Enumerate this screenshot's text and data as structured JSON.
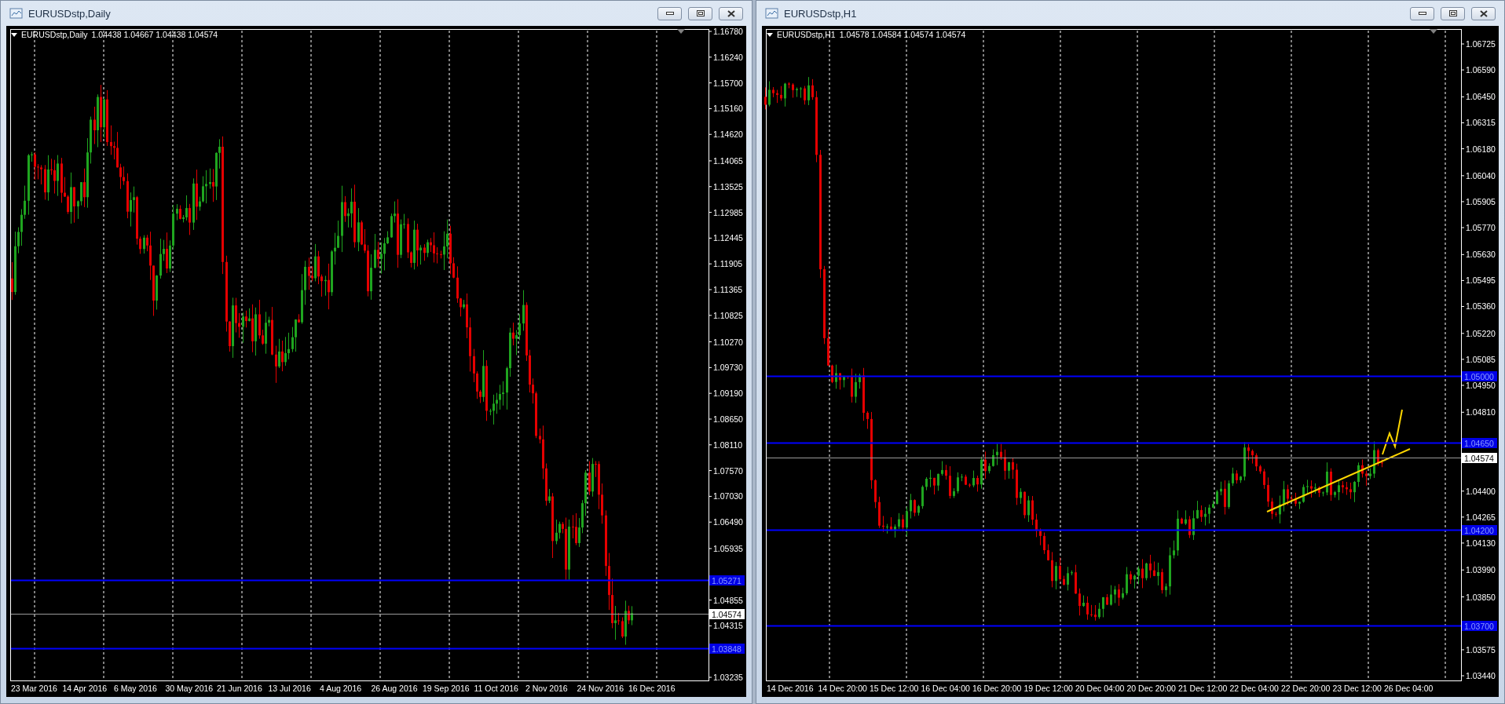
{
  "windows": [
    {
      "title": "EURUSDstp,Daily",
      "symbol": "EURUSDstp,Daily",
      "ohlc": "1.04438 1.04667 1.04438 1.04574",
      "price_axis": [
        "1.16780",
        "1.16240",
        "1.15700",
        "1.15160",
        "1.14620",
        "1.14065",
        "1.13525",
        "1.12985",
        "1.12445",
        "1.11905",
        "1.11365",
        "1.10825",
        "1.10270",
        "1.09730",
        "1.09190",
        "1.08650",
        "1.08110",
        "1.07570",
        "1.07030",
        "1.06490",
        "1.05935",
        "1.04855",
        "1.04315",
        "1.03235"
      ],
      "levels": [
        {
          "label": "1.05271",
          "kind": "line"
        },
        {
          "label": "1.04574",
          "kind": "bid"
        },
        {
          "label": "1.03848",
          "kind": "line"
        }
      ],
      "time_axis": [
        "23 Mar 2016",
        "14 Apr 2016",
        "6 May 2016",
        "30 May 2016",
        "21 Jun 2016",
        "13 Jul 2016",
        "4 Aug 2016",
        "26 Aug 2016",
        "19 Sep 2016",
        "11 Oct 2016",
        "2 Nov 2016",
        "24 Nov 2016",
        "16 Dec 2016"
      ]
    },
    {
      "title": "EURUSDstp,H1",
      "symbol": "EURUSDstp,H1",
      "ohlc": "1.04578 1.04584 1.04574 1.04574",
      "price_axis": [
        "1.06725",
        "1.06590",
        "1.06450",
        "1.06315",
        "1.06180",
        "1.06040",
        "1.05905",
        "1.05770",
        "1.05630",
        "1.05495",
        "1.05360",
        "1.05220",
        "1.05085",
        "1.04950",
        "1.04810",
        "1.04400",
        "1.04265",
        "1.04130",
        "1.03990",
        "1.03850",
        "1.03575",
        "1.03440"
      ],
      "levels": [
        {
          "label": "1.05000",
          "kind": "line"
        },
        {
          "label": "1.04650",
          "kind": "line"
        },
        {
          "label": "1.04574",
          "kind": "bid"
        },
        {
          "label": "1.04200",
          "kind": "line"
        },
        {
          "label": "1.03700",
          "kind": "line"
        }
      ],
      "time_axis": [
        "14 Dec 2016",
        "14 Dec 20:00",
        "15 Dec 12:00",
        "16 Dec 04:00",
        "16 Dec 20:00",
        "19 Dec 12:00",
        "20 Dec 04:00",
        "20 Dec 20:00",
        "21 Dec 12:00",
        "22 Dec 04:00",
        "22 Dec 20:00",
        "23 Dec 12:00",
        "26 Dec 04:00"
      ]
    }
  ]
}
